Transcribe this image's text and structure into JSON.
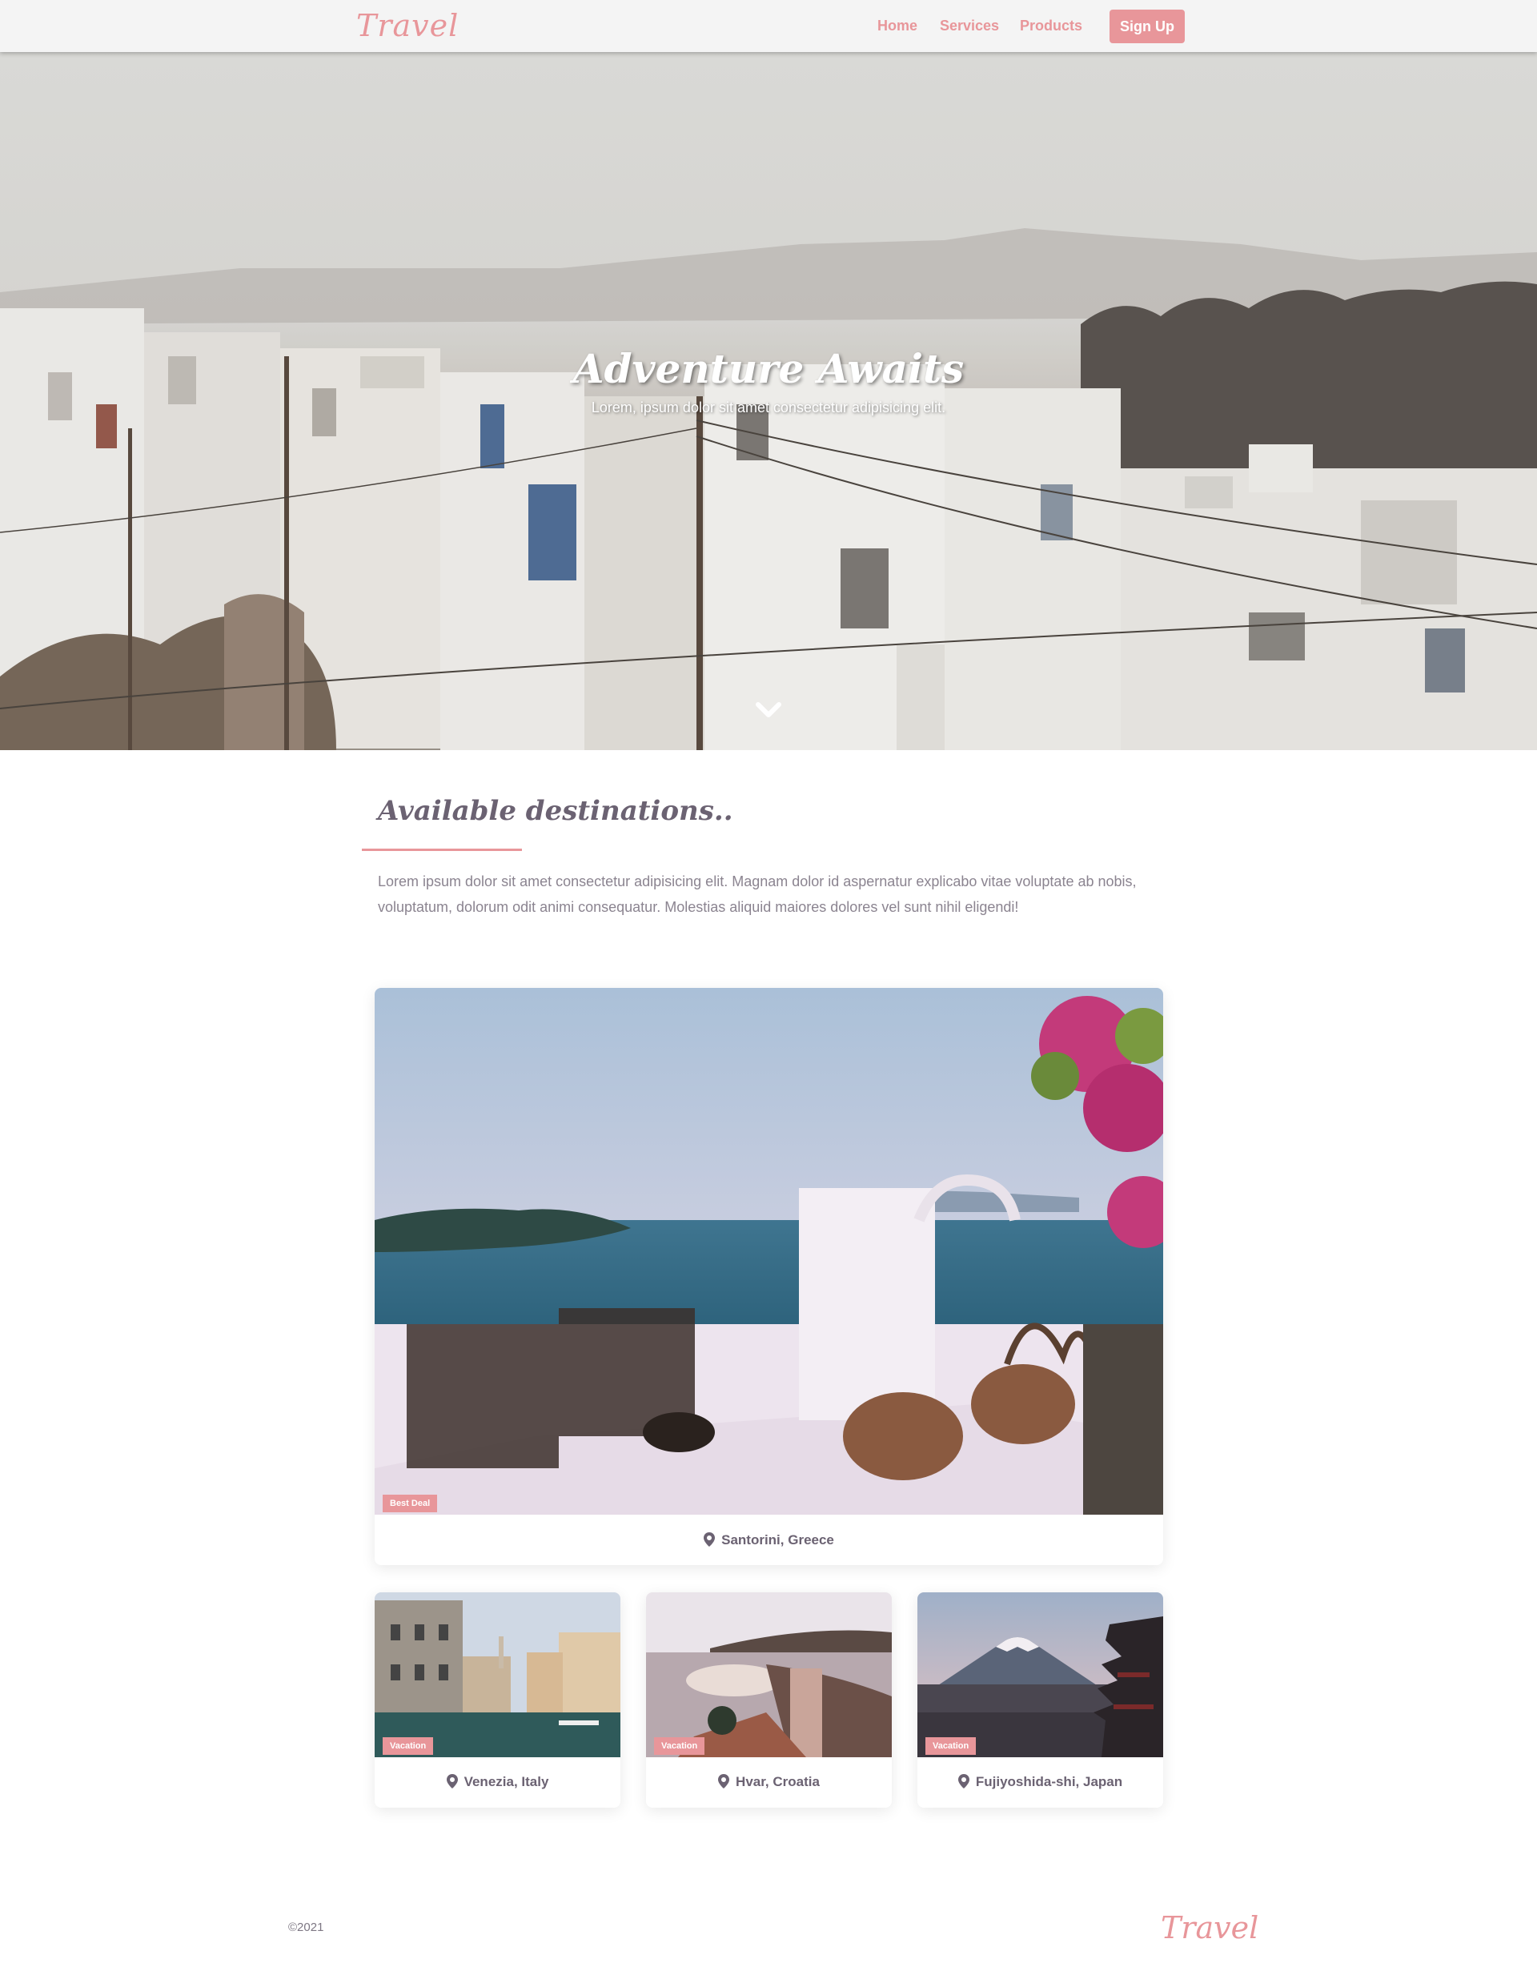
{
  "nav": {
    "logo": "Travel",
    "links": [
      "Home",
      "Services",
      "Products"
    ],
    "signup": "Sign Up"
  },
  "hero": {
    "title": "Adventure Awaits",
    "subtitle": "Lorem, ipsum dolor sit amet consectetur adipisicing elit.",
    "scroll_icon": "chevron-down-icon"
  },
  "destinations": {
    "title": "Available destinations..",
    "description": "Lorem ipsum dolor sit amet consectetur adipisicing elit. Magnam dolor id aspernatur explicabo vitae voluptate ab nobis, voluptatum, dolorum odit animi consequatur. Molestias aliquid maiores dolores vel sunt nihil eligendi!",
    "featured": {
      "badge": "Best Deal",
      "location": "Santorini, Greece"
    },
    "cards": [
      {
        "badge": "Vacation",
        "location": "Venezia, Italy"
      },
      {
        "badge": "Vacation",
        "location": "Hvar, Croatia"
      },
      {
        "badge": "Vacation",
        "location": "Fujiyoshida-shi, Japan"
      }
    ]
  },
  "footer": {
    "copyright": "©2021",
    "logo": "Travel"
  },
  "colors": {
    "accent": "#e8969a",
    "text": "#6b6272",
    "nav_bg": "#f4f4f4"
  }
}
